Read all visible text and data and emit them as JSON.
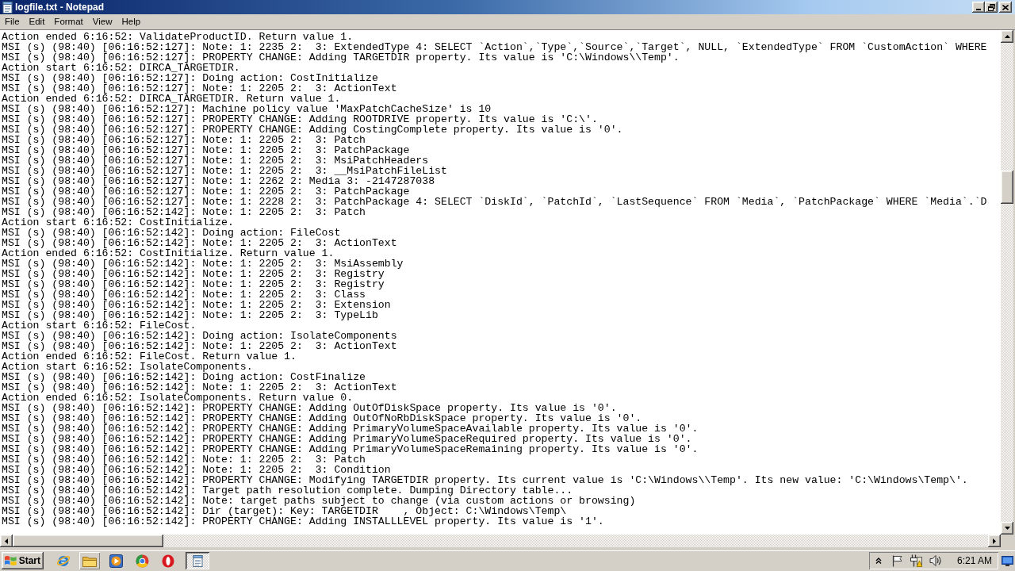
{
  "window": {
    "title": "logfile.txt - Notepad"
  },
  "menu": [
    "File",
    "Edit",
    "Format",
    "View",
    "Help"
  ],
  "lines": [
    "Action ended 6:16:52: ValidateProductID. Return value 1.",
    "MSI (s) (98:40) [06:16:52:127]: Note: 1: 2235 2:  3: ExtendedType 4: SELECT `Action`,`Type`,`Source`,`Target`, NULL, `ExtendedType` FROM `CustomAction` WHERE",
    "MSI (s) (98:40) [06:16:52:127]: PROPERTY CHANGE: Adding TARGETDIR property. Its value is 'C:\\Windows\\\\Temp'.",
    "Action start 6:16:52: DIRCA_TARGETDIR.",
    "MSI (s) (98:40) [06:16:52:127]: Doing action: CostInitialize",
    "MSI (s) (98:40) [06:16:52:127]: Note: 1: 2205 2:  3: ActionText",
    "Action ended 6:16:52: DIRCA_TARGETDIR. Return value 1.",
    "MSI (s) (98:40) [06:16:52:127]: Machine policy value 'MaxPatchCacheSize' is 10",
    "MSI (s) (98:40) [06:16:52:127]: PROPERTY CHANGE: Adding ROOTDRIVE property. Its value is 'C:\\'.",
    "MSI (s) (98:40) [06:16:52:127]: PROPERTY CHANGE: Adding CostingComplete property. Its value is '0'.",
    "MSI (s) (98:40) [06:16:52:127]: Note: 1: 2205 2:  3: Patch",
    "MSI (s) (98:40) [06:16:52:127]: Note: 1: 2205 2:  3: PatchPackage",
    "MSI (s) (98:40) [06:16:52:127]: Note: 1: 2205 2:  3: MsiPatchHeaders",
    "MSI (s) (98:40) [06:16:52:127]: Note: 1: 2205 2:  3: __MsiPatchFileList",
    "MSI (s) (98:40) [06:16:52:127]: Note: 1: 2262 2: Media 3: -2147287038",
    "MSI (s) (98:40) [06:16:52:127]: Note: 1: 2205 2:  3: PatchPackage",
    "MSI (s) (98:40) [06:16:52:127]: Note: 1: 2228 2:  3: PatchPackage 4: SELECT `DiskId`, `PatchId`, `LastSequence` FROM `Media`, `PatchPackage` WHERE `Media`.`D",
    "MSI (s) (98:40) [06:16:52:142]: Note: 1: 2205 2:  3: Patch",
    "Action start 6:16:52: CostInitialize.",
    "MSI (s) (98:40) [06:16:52:142]: Doing action: FileCost",
    "MSI (s) (98:40) [06:16:52:142]: Note: 1: 2205 2:  3: ActionText",
    "Action ended 6:16:52: CostInitialize. Return value 1.",
    "MSI (s) (98:40) [06:16:52:142]: Note: 1: 2205 2:  3: MsiAssembly",
    "MSI (s) (98:40) [06:16:52:142]: Note: 1: 2205 2:  3: Registry",
    "MSI (s) (98:40) [06:16:52:142]: Note: 1: 2205 2:  3: Registry",
    "MSI (s) (98:40) [06:16:52:142]: Note: 1: 2205 2:  3: Class",
    "MSI (s) (98:40) [06:16:52:142]: Note: 1: 2205 2:  3: Extension",
    "MSI (s) (98:40) [06:16:52:142]: Note: 1: 2205 2:  3: TypeLib",
    "Action start 6:16:52: FileCost.",
    "MSI (s) (98:40) [06:16:52:142]: Doing action: IsolateComponents",
    "MSI (s) (98:40) [06:16:52:142]: Note: 1: 2205 2:  3: ActionText",
    "Action ended 6:16:52: FileCost. Return value 1.",
    "Action start 6:16:52: IsolateComponents.",
    "MSI (s) (98:40) [06:16:52:142]: Doing action: CostFinalize",
    "MSI (s) (98:40) [06:16:52:142]: Note: 1: 2205 2:  3: ActionText",
    "Action ended 6:16:52: IsolateComponents. Return value 0.",
    "MSI (s) (98:40) [06:16:52:142]: PROPERTY CHANGE: Adding OutOfDiskSpace property. Its value is '0'.",
    "MSI (s) (98:40) [06:16:52:142]: PROPERTY CHANGE: Adding OutOfNoRbDiskSpace property. Its value is '0'.",
    "MSI (s) (98:40) [06:16:52:142]: PROPERTY CHANGE: Adding PrimaryVolumeSpaceAvailable property. Its value is '0'.",
    "MSI (s) (98:40) [06:16:52:142]: PROPERTY CHANGE: Adding PrimaryVolumeSpaceRequired property. Its value is '0'.",
    "MSI (s) (98:40) [06:16:52:142]: PROPERTY CHANGE: Adding PrimaryVolumeSpaceRemaining property. Its value is '0'.",
    "MSI (s) (98:40) [06:16:52:142]: Note: 1: 2205 2:  3: Patch",
    "MSI (s) (98:40) [06:16:52:142]: Note: 1: 2205 2:  3: Condition",
    "MSI (s) (98:40) [06:16:52:142]: PROPERTY CHANGE: Modifying TARGETDIR property. Its current value is 'C:\\Windows\\\\Temp'. Its new value: 'C:\\Windows\\Temp\\'.",
    "MSI (s) (98:40) [06:16:52:142]: Target path resolution complete. Dumping Directory table...",
    "MSI (s) (98:40) [06:16:52:142]: Note: target paths subject to change (via custom actions or browsing)",
    "MSI (s) (98:40) [06:16:52:142]: Dir (target): Key: TARGETDIR    , Object: C:\\Windows\\Temp\\",
    "MSI (s) (98:40) [06:16:52:142]: PROPERTY CHANGE: Adding INSTALLLEVEL property. Its value is '1'."
  ],
  "taskbar": {
    "start": "Start",
    "quick_launch": [
      {
        "kind": "orbit",
        "highlighted": false
      },
      {
        "kind": "folder",
        "highlighted": true
      },
      {
        "kind": "play",
        "highlighted": false
      },
      {
        "kind": "wheel",
        "highlighted": false
      },
      {
        "kind": "ring",
        "highlighted": false
      }
    ],
    "windows": [
      {
        "selected": true
      }
    ],
    "clock": "6:21 AM"
  }
}
